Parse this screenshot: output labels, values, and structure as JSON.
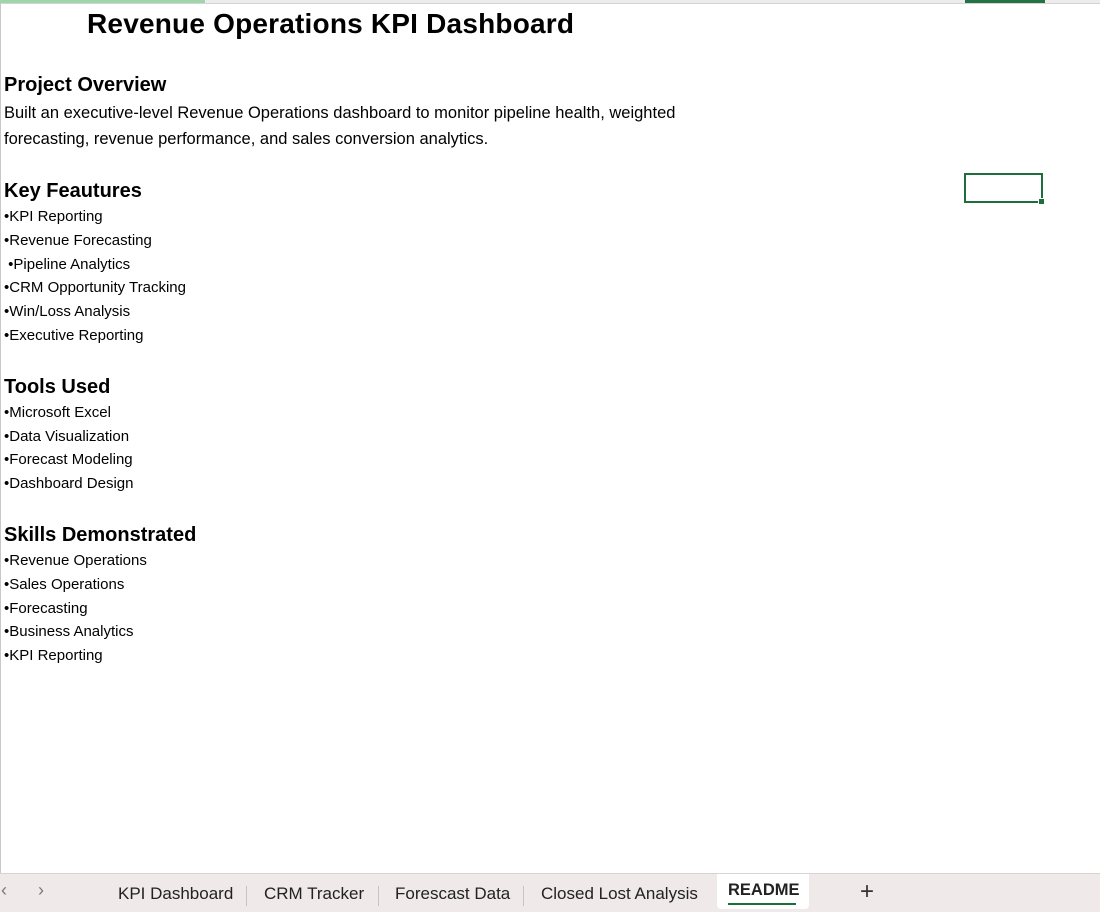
{
  "sheet": {
    "title": "Revenue Operations KPI Dashboard",
    "sections": [
      {
        "heading": "Project Overview",
        "lines": [
          "Built an executive-level Revenue Operations dashboard to monitor pipeline health, weighted",
          "forecasting, revenue performance, and sales conversion analytics."
        ]
      },
      {
        "heading": "Key Feautures",
        "bullets": [
          "•KPI Reporting",
          "•Revenue Forecasting",
          " •Pipeline Analytics",
          "•CRM Opportunity Tracking",
          "•Win/Loss Analysis",
          "•Executive Reporting"
        ]
      },
      {
        "heading": "Tools Used",
        "bullets": [
          "•Microsoft Excel",
          "•Data Visualization",
          "•Forecast Modeling",
          "•Dashboard Design"
        ]
      },
      {
        "heading": "Skills Demonstrated",
        "bullets": [
          "•Revenue Operations",
          "•Sales Operations",
          "•Forecasting",
          "•Business Analytics",
          "•KPI Reporting"
        ]
      }
    ]
  },
  "tabbar": {
    "prev_icon": "chevron-left-icon",
    "next_icon": "chevron-right-icon",
    "prev_glyph": "‹",
    "next_glyph": "›",
    "tabs": [
      {
        "label": "KPI Dashboard"
      },
      {
        "label": "CRM Tracker"
      },
      {
        "label": "Forescast Data"
      },
      {
        "label": "Closed Lost Analysis"
      },
      {
        "label": "README",
        "active": true
      }
    ],
    "add_glyph": "+"
  },
  "colors": {
    "accent": "#1e6e3c",
    "tabbar_bg": "#efe9ea"
  }
}
